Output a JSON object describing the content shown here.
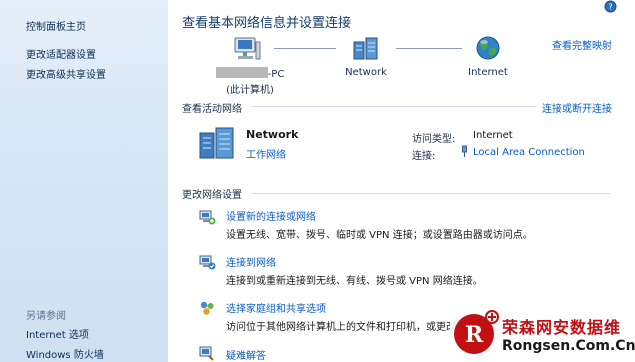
{
  "sidebar": {
    "home": "控制面板主页",
    "adapter": "更改适配器设置",
    "sharing": "更改高级共享设置",
    "see_also": "另请参阅",
    "internet_options": "Internet 选项",
    "firewall": "Windows 防火墙"
  },
  "main": {
    "title": "查看基本网络信息并设置连接",
    "full_map_link": "查看完整映射",
    "map": {
      "pc_name_suffix": "-PC",
      "pc_caption": "(此计算机)",
      "network": "Network",
      "internet": "Internet"
    },
    "active": {
      "header": "查看活动网络",
      "connect_link": "连接或断开连接",
      "name": "Network",
      "type": "工作网络",
      "access_label": "访问类型:",
      "access_value": "Internet",
      "connections_label": "连接:",
      "connection_value": "Local Area Connection"
    },
    "change": {
      "header": "更改网络设置",
      "tasks": [
        {
          "title": "设置新的连接或网络",
          "desc": "设置无线、宽带、拨号、临时或 VPN 连接；或设置路由器或访问点。"
        },
        {
          "title": "连接到网络",
          "desc": "连接到或重新连接到无线、有线、拨号或 VPN 网络连接。"
        },
        {
          "title": "选择家庭组和共享选项",
          "desc": "访问位于其他网络计算机上的文件和打印机，或更改共享设置。"
        },
        {
          "title": "疑难解答",
          "desc": ""
        }
      ]
    }
  },
  "watermark": {
    "cn": "荣森网安数据维",
    "en": "Rongsen.Com.Cn",
    "logo_letter": "R"
  },
  "colors": {
    "link": "#0a5cc7",
    "left_pane": "#d6e6f5",
    "watermark_red": "#c20f14"
  }
}
